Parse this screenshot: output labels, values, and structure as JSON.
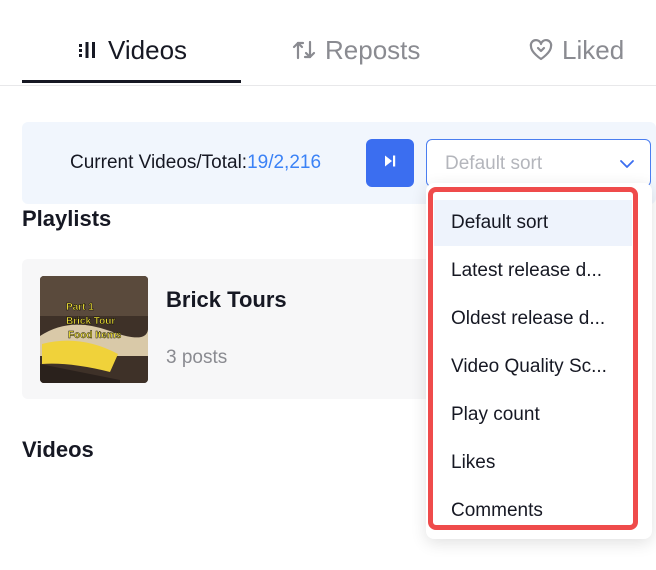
{
  "tabs": [
    {
      "label": "Videos",
      "icon": "grid-bars-icon",
      "active": true
    },
    {
      "label": "Reposts",
      "icon": "repost-arrows-icon",
      "active": false
    },
    {
      "label": "Liked",
      "icon": "heart-broken-icon",
      "active": false
    }
  ],
  "toolbar": {
    "count_label": "Current Videos/Total:",
    "count_value": "19/2,216",
    "sort_placeholder": "Default sort"
  },
  "playlists": {
    "title": "Playlists",
    "items": [
      {
        "name": "Brick Tours",
        "count": "3 posts",
        "thumb_text": [
          "Part 1",
          "Brick Tour",
          "Food Items"
        ]
      }
    ]
  },
  "videos": {
    "title": "Videos"
  },
  "sort_menu": {
    "selected": "Default sort",
    "items": [
      "Default sort",
      "Latest release d...",
      "Oldest release d...",
      "Video Quality Sc...",
      "Play count",
      "Likes",
      "Comments"
    ]
  },
  "colors": {
    "accent": "#3b6ef0",
    "count_value": "#3b82f6",
    "highlight": "#ef4b4b",
    "toolbar_bg": "#f1f6fd"
  }
}
